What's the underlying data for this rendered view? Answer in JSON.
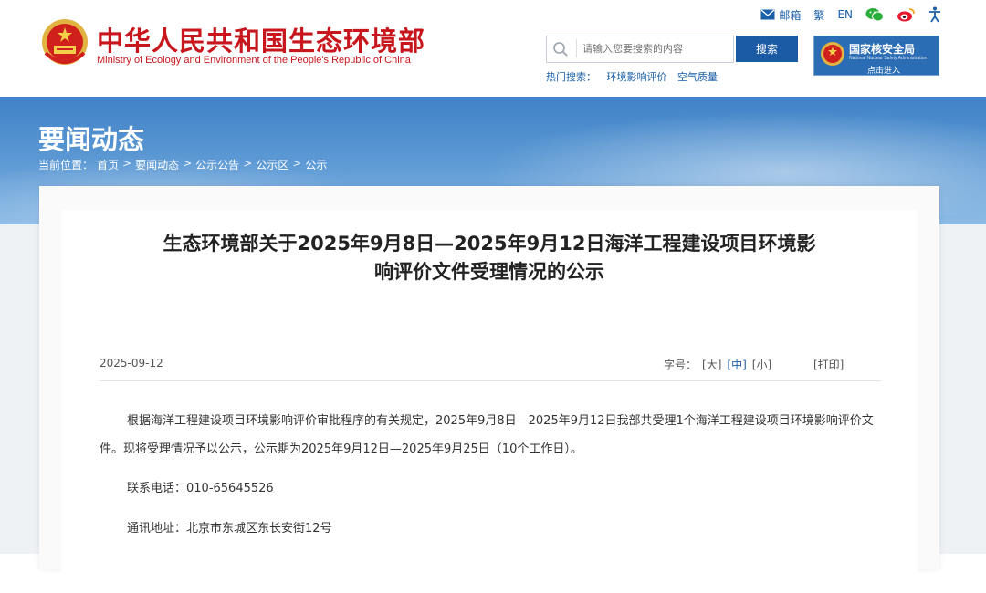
{
  "header": {
    "site_title": "中华人民共和国生态环境部",
    "site_subtitle": "Ministry of Ecology and Environment of the People's Republic of China",
    "top_links": {
      "mail": "邮箱",
      "traditional": "繁",
      "english": "EN"
    },
    "search": {
      "placeholder": "请输入您要搜索的内容",
      "button": "搜索"
    },
    "hot_search": {
      "label": "热门搜索：",
      "items": [
        "环境影响评价",
        "空气质量"
      ]
    },
    "nsa": {
      "title": "国家核安全局",
      "english": "National Nuclear Safety Administration",
      "enter": "点击进入"
    },
    "colors": {
      "brand_red": "#c8161d",
      "brand_blue": "#1b5aa4"
    }
  },
  "banner": {
    "title": "要闻动态",
    "breadcrumb": {
      "prefix": "当前位置：",
      "items": [
        "首页",
        "要闻动态",
        "公示公告",
        "公示区",
        "公示"
      ],
      "separator": ">"
    }
  },
  "article": {
    "title_line1": "生态环境部关于2025年9月8日—2025年9月12日海洋工程建设项目环境影",
    "title_line2": "响评价文件受理情况的公示",
    "date": "2025-09-12",
    "font_size": {
      "label": "字号：",
      "large": "[大]",
      "medium": "[中]",
      "small": "[小]"
    },
    "print": "[打印]",
    "paragraph1": "根据海洋工程建设项目环境影响评价审批程序的有关规定，2025年9月8日—2025年9月12日我部共受理1个海洋工程建设项目环境影响评价文件。现将受理情况予以公示，公示期为2025年9月12日—2025年9月25日（10个工作日）。",
    "phone": "联系电话：010-65645526",
    "address": "通讯地址：北京市东城区东长安街12号"
  }
}
